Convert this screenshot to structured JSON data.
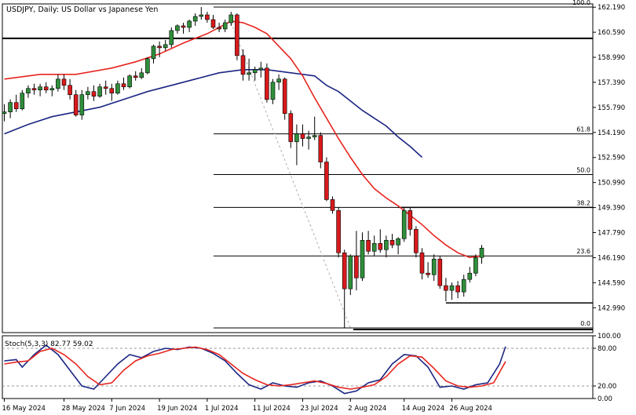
{
  "header": {
    "title": "USDJPY, Daily:  US Dollar vs Japanese Yen"
  },
  "colors": {
    "bull": "#2f8f3a",
    "bear": "#d9191c",
    "ma_fast": "#e8251f",
    "ma_slow": "#1b2683",
    "stoch_k": "#1b2683",
    "stoch_d": "#e8251f",
    "fib": "#000000",
    "trendline": "#b0b0b0"
  },
  "chart_data": [
    {
      "type": "candlestick",
      "title": "USDJPY, Daily:  US Dollar vs Japanese Yen",
      "ylim": [
        141.4,
        162.4
      ],
      "y_ticks": [
        "162.190",
        "160.590",
        "158.990",
        "157.390",
        "155.790",
        "154.190",
        "152.590",
        "150.990",
        "149.390",
        "147.790",
        "146.190",
        "144.590",
        "142.990"
      ],
      "x_ticks": [
        "16 May 2024",
        "28 May 2024",
        "7 Jun 2024",
        "19 Jun 2024",
        "1 Jul 2024",
        "11 Jul 2024",
        "23 Jul 2024",
        "2 Aug 2024",
        "14 Aug 2024",
        "26 Aug 2024"
      ],
      "x_tick_index": [
        0,
        10,
        18,
        26,
        34,
        42,
        50,
        58,
        67,
        75
      ],
      "candles": [
        {
          "o": 155.4,
          "h": 156.0,
          "l": 154.9,
          "c": 155.5
        },
        {
          "o": 155.5,
          "h": 156.3,
          "l": 155.1,
          "c": 156.1
        },
        {
          "o": 156.1,
          "h": 156.6,
          "l": 155.5,
          "c": 155.7
        },
        {
          "o": 155.7,
          "h": 156.9,
          "l": 155.6,
          "c": 156.7
        },
        {
          "o": 156.7,
          "h": 157.2,
          "l": 156.4,
          "c": 157.0
        },
        {
          "o": 157.0,
          "h": 157.3,
          "l": 156.6,
          "c": 156.9
        },
        {
          "o": 156.9,
          "h": 157.3,
          "l": 156.5,
          "c": 157.1
        },
        {
          "o": 157.1,
          "h": 157.4,
          "l": 156.7,
          "c": 156.9
        },
        {
          "o": 156.9,
          "h": 157.2,
          "l": 156.5,
          "c": 157.0
        },
        {
          "o": 157.0,
          "h": 157.9,
          "l": 156.8,
          "c": 157.6
        },
        {
          "o": 157.6,
          "h": 157.9,
          "l": 156.9,
          "c": 157.2
        },
        {
          "o": 157.2,
          "h": 157.6,
          "l": 156.3,
          "c": 156.6
        },
        {
          "o": 156.6,
          "h": 156.9,
          "l": 155.2,
          "c": 155.3
        },
        {
          "o": 155.3,
          "h": 156.9,
          "l": 155.0,
          "c": 156.6
        },
        {
          "o": 156.6,
          "h": 157.1,
          "l": 156.3,
          "c": 156.8
        },
        {
          "o": 156.8,
          "h": 157.2,
          "l": 156.2,
          "c": 156.5
        },
        {
          "o": 156.5,
          "h": 157.3,
          "l": 156.4,
          "c": 157.1
        },
        {
          "o": 157.1,
          "h": 157.5,
          "l": 156.6,
          "c": 157.0
        },
        {
          "o": 157.0,
          "h": 157.3,
          "l": 156.2,
          "c": 156.7
        },
        {
          "o": 156.7,
          "h": 157.5,
          "l": 156.6,
          "c": 157.3
        },
        {
          "o": 157.3,
          "h": 157.7,
          "l": 156.9,
          "c": 157.1
        },
        {
          "o": 157.1,
          "h": 157.9,
          "l": 157.0,
          "c": 157.8
        },
        {
          "o": 157.8,
          "h": 158.1,
          "l": 157.5,
          "c": 157.7
        },
        {
          "o": 157.7,
          "h": 158.3,
          "l": 157.6,
          "c": 158.0
        },
        {
          "o": 158.0,
          "h": 159.0,
          "l": 157.9,
          "c": 158.9
        },
        {
          "o": 158.9,
          "h": 159.8,
          "l": 158.6,
          "c": 159.7
        },
        {
          "o": 159.7,
          "h": 160.0,
          "l": 159.0,
          "c": 159.6
        },
        {
          "o": 159.6,
          "h": 160.1,
          "l": 159.4,
          "c": 159.8
        },
        {
          "o": 159.8,
          "h": 160.9,
          "l": 159.6,
          "c": 160.7
        },
        {
          "o": 160.7,
          "h": 161.1,
          "l": 160.5,
          "c": 161.0
        },
        {
          "o": 161.0,
          "h": 161.2,
          "l": 160.5,
          "c": 160.9
        },
        {
          "o": 160.9,
          "h": 161.4,
          "l": 160.6,
          "c": 161.3
        },
        {
          "o": 161.3,
          "h": 161.8,
          "l": 161.0,
          "c": 161.6
        },
        {
          "o": 161.6,
          "h": 162.2,
          "l": 161.4,
          "c": 161.7
        },
        {
          "o": 161.7,
          "h": 161.9,
          "l": 161.2,
          "c": 161.4
        },
        {
          "o": 161.4,
          "h": 161.7,
          "l": 160.8,
          "c": 160.9
        },
        {
          "o": 160.9,
          "h": 161.2,
          "l": 160.6,
          "c": 160.8
        },
        {
          "o": 160.8,
          "h": 161.4,
          "l": 160.6,
          "c": 161.2
        },
        {
          "o": 161.2,
          "h": 161.9,
          "l": 161.0,
          "c": 161.7
        },
        {
          "o": 161.7,
          "h": 161.8,
          "l": 158.8,
          "c": 159.1
        },
        {
          "o": 159.1,
          "h": 159.5,
          "l": 157.5,
          "c": 157.9
        },
        {
          "o": 157.9,
          "h": 158.9,
          "l": 157.5,
          "c": 158.0
        },
        {
          "o": 158.0,
          "h": 158.4,
          "l": 157.5,
          "c": 158.2
        },
        {
          "o": 158.2,
          "h": 158.7,
          "l": 157.7,
          "c": 158.3
        },
        {
          "o": 158.3,
          "h": 158.6,
          "l": 156.1,
          "c": 156.3
        },
        {
          "o": 156.3,
          "h": 157.6,
          "l": 156.0,
          "c": 157.4
        },
        {
          "o": 157.4,
          "h": 157.9,
          "l": 156.9,
          "c": 157.6
        },
        {
          "o": 157.6,
          "h": 157.7,
          "l": 155.0,
          "c": 155.4
        },
        {
          "o": 155.4,
          "h": 155.6,
          "l": 153.2,
          "c": 153.6
        },
        {
          "o": 153.6,
          "h": 154.7,
          "l": 152.1,
          "c": 154.1
        },
        {
          "o": 154.1,
          "h": 154.7,
          "l": 153.3,
          "c": 153.8
        },
        {
          "o": 153.8,
          "h": 154.3,
          "l": 153.1,
          "c": 153.9
        },
        {
          "o": 153.9,
          "h": 155.2,
          "l": 153.7,
          "c": 154.0
        },
        {
          "o": 154.0,
          "h": 154.2,
          "l": 151.9,
          "c": 152.3
        },
        {
          "o": 152.3,
          "h": 152.6,
          "l": 149.8,
          "c": 149.9
        },
        {
          "o": 149.9,
          "h": 150.1,
          "l": 149.0,
          "c": 149.2
        },
        {
          "o": 149.2,
          "h": 149.4,
          "l": 146.2,
          "c": 146.5
        },
        {
          "o": 146.5,
          "h": 146.7,
          "l": 141.7,
          "c": 144.2
        },
        {
          "o": 144.2,
          "h": 146.4,
          "l": 143.8,
          "c": 146.3
        },
        {
          "o": 146.3,
          "h": 147.9,
          "l": 144.1,
          "c": 144.9
        },
        {
          "o": 144.9,
          "h": 147.8,
          "l": 144.7,
          "c": 147.3
        },
        {
          "o": 147.3,
          "h": 147.9,
          "l": 146.4,
          "c": 146.6
        },
        {
          "o": 146.6,
          "h": 147.6,
          "l": 146.3,
          "c": 147.1
        },
        {
          "o": 147.1,
          "h": 148.0,
          "l": 146.5,
          "c": 146.7
        },
        {
          "o": 146.7,
          "h": 147.6,
          "l": 146.2,
          "c": 147.3
        },
        {
          "o": 147.3,
          "h": 147.7,
          "l": 146.8,
          "c": 147.0
        },
        {
          "o": 147.0,
          "h": 147.5,
          "l": 146.4,
          "c": 147.4
        },
        {
          "o": 147.4,
          "h": 149.4,
          "l": 147.2,
          "c": 149.2
        },
        {
          "o": 149.2,
          "h": 149.4,
          "l": 147.6,
          "c": 148.0
        },
        {
          "o": 148.0,
          "h": 148.2,
          "l": 146.2,
          "c": 146.5
        },
        {
          "o": 146.5,
          "h": 146.8,
          "l": 144.8,
          "c": 145.2
        },
        {
          "o": 145.2,
          "h": 145.9,
          "l": 144.9,
          "c": 145.1
        },
        {
          "o": 145.1,
          "h": 146.4,
          "l": 144.7,
          "c": 146.1
        },
        {
          "o": 146.1,
          "h": 146.3,
          "l": 144.2,
          "c": 144.4
        },
        {
          "o": 144.4,
          "h": 144.9,
          "l": 143.4,
          "c": 144.1
        },
        {
          "o": 144.1,
          "h": 144.6,
          "l": 143.5,
          "c": 144.4
        },
        {
          "o": 144.4,
          "h": 144.7,
          "l": 143.6,
          "c": 144.0
        },
        {
          "o": 144.0,
          "h": 145.1,
          "l": 143.7,
          "c": 144.8
        },
        {
          "o": 144.8,
          "h": 145.6,
          "l": 144.6,
          "c": 145.2
        },
        {
          "o": 145.2,
          "h": 146.4,
          "l": 145.0,
          "c": 146.2
        },
        {
          "o": 146.2,
          "h": 147.0,
          "l": 145.8,
          "c": 146.8
        }
      ],
      "ma_fast": [
        [
          0,
          157.6
        ],
        [
          6,
          157.9
        ],
        [
          12,
          157.9
        ],
        [
          18,
          158.3
        ],
        [
          22,
          158.7
        ],
        [
          26,
          159.2
        ],
        [
          30,
          159.9
        ],
        [
          34,
          160.5
        ],
        [
          36,
          160.9
        ],
        [
          38,
          161.3
        ],
        [
          40,
          161.2
        ],
        [
          42,
          160.9
        ],
        [
          44,
          160.5
        ],
        [
          46,
          159.7
        ],
        [
          48,
          158.9
        ],
        [
          50,
          157.8
        ],
        [
          52,
          156.4
        ],
        [
          54,
          155.1
        ],
        [
          56,
          153.8
        ],
        [
          58,
          152.6
        ],
        [
          60,
          151.5
        ],
        [
          62,
          150.6
        ],
        [
          64,
          150.0
        ],
        [
          66,
          149.5
        ],
        [
          68,
          148.9
        ],
        [
          70,
          148.3
        ],
        [
          72,
          147.6
        ],
        [
          74,
          147.0
        ],
        [
          76,
          146.5
        ],
        [
          78,
          146.2
        ],
        [
          80,
          146.3
        ]
      ],
      "ma_slow": [
        [
          0,
          154.1
        ],
        [
          4,
          154.7
        ],
        [
          8,
          155.2
        ],
        [
          12,
          155.5
        ],
        [
          16,
          155.8
        ],
        [
          20,
          156.3
        ],
        [
          24,
          156.8
        ],
        [
          28,
          157.2
        ],
        [
          32,
          157.6
        ],
        [
          36,
          158.0
        ],
        [
          40,
          158.2
        ],
        [
          44,
          158.2
        ],
        [
          48,
          158.0
        ],
        [
          52,
          157.8
        ],
        [
          54,
          157.2
        ],
        [
          56,
          156.8
        ],
        [
          58,
          156.2
        ],
        [
          60,
          155.6
        ],
        [
          62,
          155.1
        ],
        [
          64,
          154.6
        ],
        [
          66,
          153.9
        ],
        [
          68,
          153.3
        ],
        [
          70,
          152.6
        ]
      ],
      "annotations": {
        "horizontal_levels": [
          160.2,
          141.6
        ],
        "support_line": {
          "from_index": 74,
          "to_index": 80,
          "value": 143.3
        },
        "resistance_line": {
          "from_index": 66,
          "to_index": 80,
          "value": 149.4
        },
        "trendline": {
          "from_index": 38,
          "from_value": 161.2,
          "to_index": 58,
          "to_value": 141.7
        }
      },
      "fibonacci": [
        {
          "label": "100.0",
          "value": 162.2
        },
        {
          "label": "61.8",
          "value": 154.1
        },
        {
          "label": "50.0",
          "value": 151.5
        },
        {
          "label": "38.2",
          "value": 149.4
        },
        {
          "label": "23.6",
          "value": 146.3
        },
        {
          "label": "0.0",
          "value": 141.7
        }
      ]
    },
    {
      "type": "line",
      "title": "Stoch(5,3,3) 82.77 59.02",
      "ylim": [
        0,
        100
      ],
      "y_ticks": [
        "100.00",
        "80.00",
        "20.00",
        "0.00"
      ],
      "levels": [
        80,
        20
      ],
      "series": [
        {
          "color": "#1b2683",
          "values": [
            [
              0,
              60
            ],
            [
              2,
              62
            ],
            [
              3,
              50
            ],
            [
              5,
              70
            ],
            [
              7,
              85
            ],
            [
              9,
              70
            ],
            [
              11,
              45
            ],
            [
              13,
              20
            ],
            [
              15,
              15
            ],
            [
              17,
              35
            ],
            [
              19,
              55
            ],
            [
              21,
              70
            ],
            [
              23,
              65
            ],
            [
              25,
              75
            ],
            [
              27,
              80
            ],
            [
              29,
              78
            ],
            [
              31,
              82
            ],
            [
              33,
              80
            ],
            [
              35,
              72
            ],
            [
              37,
              60
            ],
            [
              39,
              40
            ],
            [
              41,
              22
            ],
            [
              43,
              15
            ],
            [
              45,
              25
            ],
            [
              47,
              20
            ],
            [
              49,
              18
            ],
            [
              51,
              25
            ],
            [
              53,
              28
            ],
            [
              55,
              20
            ],
            [
              57,
              8
            ],
            [
              59,
              12
            ],
            [
              61,
              25
            ],
            [
              63,
              30
            ],
            [
              65,
              55
            ],
            [
              67,
              70
            ],
            [
              69,
              68
            ],
            [
              71,
              50
            ],
            [
              73,
              18
            ],
            [
              75,
              20
            ],
            [
              77,
              15
            ],
            [
              79,
              22
            ],
            [
              81,
              25
            ],
            [
              83,
              55
            ],
            [
              84,
              82.77
            ]
          ]
        },
        {
          "color": "#e8251f",
          "values": [
            [
              0,
              55
            ],
            [
              2,
              58
            ],
            [
              4,
              60
            ],
            [
              6,
              75
            ],
            [
              8,
              80
            ],
            [
              10,
              70
            ],
            [
              12,
              55
            ],
            [
              14,
              35
            ],
            [
              16,
              22
            ],
            [
              18,
              25
            ],
            [
              20,
              45
            ],
            [
              22,
              60
            ],
            [
              24,
              68
            ],
            [
              26,
              72
            ],
            [
              28,
              78
            ],
            [
              30,
              80
            ],
            [
              32,
              82
            ],
            [
              34,
              78
            ],
            [
              36,
              70
            ],
            [
              38,
              55
            ],
            [
              40,
              40
            ],
            [
              42,
              30
            ],
            [
              44,
              22
            ],
            [
              46,
              20
            ],
            [
              48,
              22
            ],
            [
              50,
              25
            ],
            [
              52,
              28
            ],
            [
              54,
              24
            ],
            [
              56,
              18
            ],
            [
              58,
              15
            ],
            [
              60,
              18
            ],
            [
              62,
              22
            ],
            [
              64,
              35
            ],
            [
              66,
              55
            ],
            [
              68,
              68
            ],
            [
              70,
              66
            ],
            [
              72,
              48
            ],
            [
              74,
              28
            ],
            [
              76,
              20
            ],
            [
              78,
              18
            ],
            [
              80,
              20
            ],
            [
              82,
              25
            ],
            [
              84,
              59.02
            ]
          ]
        }
      ]
    }
  ]
}
